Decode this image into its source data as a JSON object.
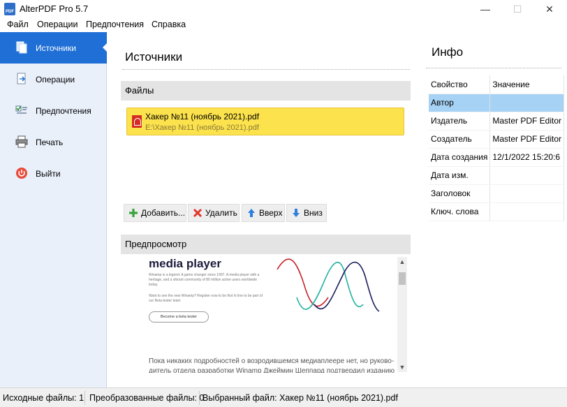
{
  "window": {
    "title": "AlterPDF Pro 5.7",
    "icon_label": "PDF",
    "controls": {
      "minimize": "—",
      "maximize": "☐",
      "close": "✕"
    }
  },
  "menu": [
    "Файл",
    "Операции",
    "Предпочтения",
    "Справка"
  ],
  "nav": {
    "items": [
      {
        "label": "Источники",
        "icon": "pages-icon",
        "active": true
      },
      {
        "label": "Операции",
        "icon": "document-arrow-icon",
        "active": false
      },
      {
        "label": "Предпочтения",
        "icon": "checklist-icon",
        "active": false
      },
      {
        "label": "Печать",
        "icon": "printer-icon",
        "active": false
      },
      {
        "label": "Выйти",
        "icon": "power-icon",
        "active": false
      }
    ]
  },
  "main": {
    "title": "Источники",
    "files_header": "Файлы",
    "files": [
      {
        "name": "Хакер №11 (ноябрь 2021).pdf",
        "path": "E:\\Хакер №11 (ноябрь 2021).pdf"
      }
    ],
    "buttons": {
      "add": "Добавить...",
      "delete": "Удалить",
      "up": "Вверх",
      "down": "Вниз"
    },
    "preview_header": "Предпросмотр",
    "preview": {
      "heading": "media player",
      "lines": [
        "Winamp is a legend. A game changer since 1997. A media player with a",
        "heritage, and a vibrant community of 80 million active users worldwide",
        "today.",
        "Want to see the new Winamp? Register now to be first in line to be part of",
        "our Beta-tester team"
      ],
      "cta": "Become a beta tester",
      "body_1": "Пока никаких подробностей о возродившемся медиаплеере нет, но руково-",
      "body_2": "дитель отдела разработки Winamp Джеймин Шеппард подтвердил изданию"
    }
  },
  "info": {
    "title": "Инфо",
    "columns": [
      "Свойство",
      "Значение"
    ],
    "rows": [
      {
        "key": "Автор",
        "value": "",
        "selected": true
      },
      {
        "key": "Издатель",
        "value": "Master PDF Editor",
        "selected": false
      },
      {
        "key": "Создатель",
        "value": "Master PDF Editor",
        "selected": false
      },
      {
        "key": "Дата создания",
        "value": "12/1/2022 15:20:6",
        "selected": false
      },
      {
        "key": "Дата изм.",
        "value": "",
        "selected": false
      },
      {
        "key": "Заголовок",
        "value": "",
        "selected": false
      },
      {
        "key": "Ключ. слова",
        "value": "",
        "selected": false
      }
    ]
  },
  "status": {
    "source_files": "Исходные файлы: 1",
    "converted_files": "Преобразованные файлы: 0",
    "selected_file": "Выбранный файл: Хакер №11 (ноябрь 2021).pdf"
  },
  "colors": {
    "accent": "#1f6fd6",
    "nav_bg": "#e9f0fa",
    "file_highlight": "#fce24c",
    "selected_row": "#a6d2f5"
  }
}
